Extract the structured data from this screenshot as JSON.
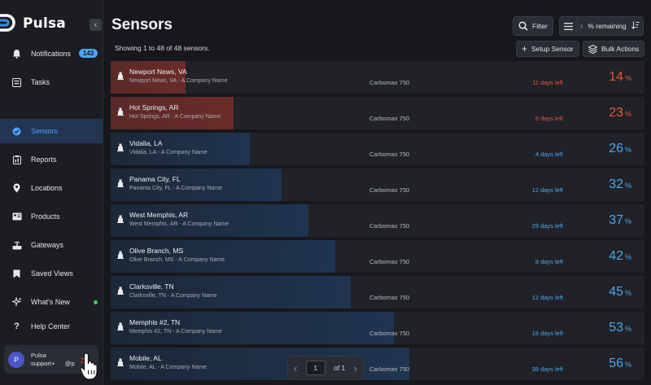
{
  "app": {
    "name": "Pulsa"
  },
  "sidebar": {
    "items": [
      {
        "label": "Notifications",
        "icon": "bell-icon",
        "badge": "143"
      },
      {
        "label": "Tasks",
        "icon": "tasks-icon"
      },
      {
        "label": "Sensors",
        "icon": "sensor-icon",
        "active": true
      },
      {
        "label": "Reports",
        "icon": "report-icon"
      },
      {
        "label": "Locations",
        "icon": "location-pin-icon"
      },
      {
        "label": "Products",
        "icon": "products-icon"
      },
      {
        "label": "Gateways",
        "icon": "gateway-icon"
      },
      {
        "label": "Saved Views",
        "icon": "bookmark-icon"
      },
      {
        "label": "What's New",
        "icon": "sparkle-icon"
      },
      {
        "label": "Help Center",
        "icon": "question-icon"
      }
    ],
    "user": {
      "initial": "P",
      "name": "Pulsa",
      "email": "support+      @p"
    }
  },
  "header": {
    "title": "Sensors",
    "filter_label": "Filter",
    "sort_label": "% remaining",
    "count_text": "Showing 1 to 48 of 48 sensors.",
    "setup_label": "Setup Sensor",
    "bulk_label": "Bulk Actions"
  },
  "colors": {
    "low": "#e8563a",
    "ok": "#4aa8f0",
    "low_fill": "#5a2a28",
    "ok_fill": "#1f3450"
  },
  "sensors": [
    {
      "name": "Newport News, VA",
      "sub": "Newport News, VA - A Company Name",
      "model": "Carbomax 750",
      "days": "11 days left",
      "pct": "14",
      "level": 14,
      "status": "low"
    },
    {
      "name": "Hot Springs, AR",
      "sub": "Hot Springs, AR - A Company Name",
      "model": "Carbomax 750",
      "days": "8 days left",
      "pct": "23",
      "level": 23,
      "status": "low"
    },
    {
      "name": "Vidalia, LA",
      "sub": "Vidalia, LA - A Company Name",
      "model": "Carbomax 750",
      "days": "4 days left",
      "pct": "26",
      "level": 26,
      "status": "ok"
    },
    {
      "name": "Panama City, FL",
      "sub": "Panama City, FL - A Company Name",
      "model": "Carbomax 750",
      "days": "12 days left",
      "pct": "32",
      "level": 32,
      "status": "ok"
    },
    {
      "name": "West Memphis, AR",
      "sub": "West Memphis, AR - A Company Name",
      "model": "Carbomax 750",
      "days": "29 days left",
      "pct": "37",
      "level": 37,
      "status": "ok"
    },
    {
      "name": "Olive Branch, MS",
      "sub": "Olive Branch, MS - A Company Name",
      "model": "Carbomax 750",
      "days": "8 days left",
      "pct": "42",
      "level": 42,
      "status": "ok"
    },
    {
      "name": "Clarksville, TN",
      "sub": "Clarksville, TN - A Company Name",
      "model": "Carbomax 750",
      "days": "12 days left",
      "pct": "45",
      "level": 45,
      "status": "ok"
    },
    {
      "name": "Memphis #2, TN",
      "sub": "Memphis #2, TN - A Company Name",
      "model": "Carbomax 750",
      "days": "18 days left",
      "pct": "53",
      "level": 53,
      "status": "ok"
    },
    {
      "name": "Mobile, AL",
      "sub": "Mobile, AL - A Company Name",
      "model": "Carbomax 750",
      "days": "39 days left",
      "pct": "56",
      "level": 56,
      "status": "ok"
    }
  ],
  "pct_unit": "%",
  "pager": {
    "page": "1",
    "of_text": "of 1"
  }
}
